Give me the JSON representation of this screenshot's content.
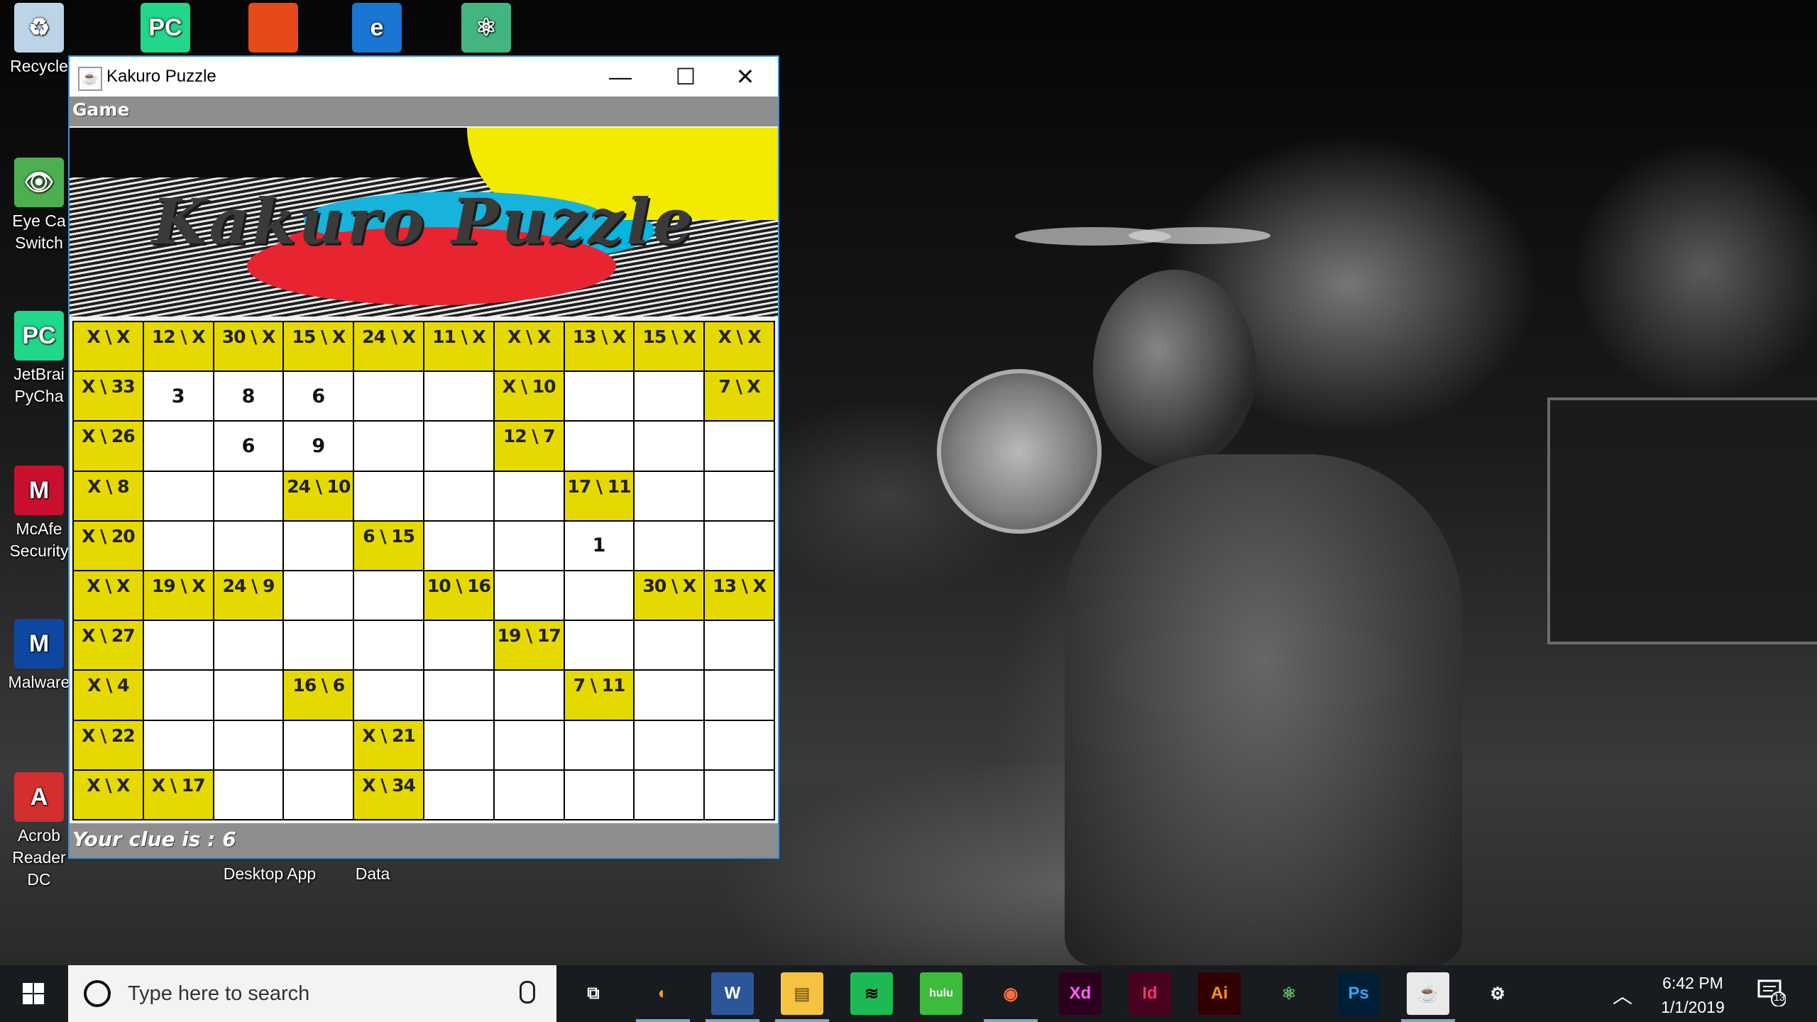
{
  "desktop": {
    "icons": [
      {
        "label": "Recycle",
        "glyph": "♻",
        "color": "#bcd3e8"
      },
      {
        "label": "Eye Ca\nSwitch",
        "glyph": "👁",
        "color": "#4caf50"
      },
      {
        "label": "JetBrai\nPyCha",
        "glyph": "PC",
        "color": "#21d789"
      },
      {
        "label": "McAfe\nSecurity",
        "glyph": "M",
        "color": "#c8102e"
      },
      {
        "label": "Malware",
        "glyph": "M",
        "color": "#0d47a1"
      },
      {
        "label": "Acrob\nReader DC",
        "glyph": "A",
        "color": "#d32f2f"
      }
    ],
    "top_icons": [
      {
        "label": "PC",
        "color": "#21d789"
      },
      {
        "label": "",
        "color": "#e64a19"
      },
      {
        "label": "e",
        "color": "#1976d2"
      },
      {
        "label": "⚛",
        "color": "#43b581"
      }
    ],
    "bottom_labels": [
      "Desktop App",
      "Data"
    ]
  },
  "window": {
    "title": "Kakuro Puzzle",
    "menu": [
      "Game"
    ],
    "banner_title": "Kakuro Puzzle",
    "controls": {
      "minimize": "—",
      "maximize": "☐",
      "close": "✕"
    },
    "status": "Your clue is :  6"
  },
  "grid": [
    [
      "X \\ X",
      "12 \\ X",
      "30 \\ X",
      "15 \\ X",
      "24 \\ X",
      "11 \\ X",
      "X \\ X",
      "13 \\ X",
      "15 \\ X",
      "X \\ X"
    ],
    [
      "X \\ 33",
      "3",
      "8",
      "6",
      "",
      "",
      "X \\ 10",
      "",
      "",
      "7 \\ X"
    ],
    [
      "X \\ 26",
      "",
      "6",
      "9",
      "",
      "",
      "12 \\ 7",
      "",
      "",
      ""
    ],
    [
      "X \\ 8",
      "",
      "",
      "24 \\ 10",
      "",
      "",
      "",
      "17 \\ 11",
      "",
      ""
    ],
    [
      "X \\ 20",
      "",
      "",
      "",
      "6 \\ 15",
      "",
      "",
      "1",
      "",
      ""
    ],
    [
      "X \\ X",
      "19 \\ X",
      "24 \\ 9",
      "",
      "",
      "10 \\ 16",
      "",
      "",
      "30 \\ X",
      "13 \\ X"
    ],
    [
      "X \\ 27",
      "",
      "",
      "",
      "",
      "",
      "19 \\ 17",
      "",
      "",
      ""
    ],
    [
      "X \\ 4",
      "",
      "",
      "16 \\ 6",
      "",
      "",
      "",
      "7 \\ 11",
      "",
      ""
    ],
    [
      "X \\ 22",
      "",
      "",
      "",
      "X \\ 21",
      "",
      "",
      "",
      "",
      ""
    ],
    [
      "X \\ X",
      "X \\ 17",
      "",
      "",
      "X \\ 34",
      "",
      "",
      "",
      "",
      ""
    ]
  ],
  "taskbar": {
    "search_placeholder": "Type here to search",
    "apps": [
      {
        "name": "task-view",
        "label": "⧉",
        "bg": "transparent",
        "fg": "#fff"
      },
      {
        "name": "eclipse",
        "label": "◐",
        "bg": "transparent",
        "fg": "#f0a030"
      },
      {
        "name": "word",
        "label": "W",
        "bg": "#2b579a",
        "fg": "#fff"
      },
      {
        "name": "file-explorer",
        "label": "▤",
        "bg": "#f5c242",
        "fg": "#8a6d1a"
      },
      {
        "name": "spotify",
        "label": "≋",
        "bg": "#1db954",
        "fg": "#000"
      },
      {
        "name": "hulu",
        "label": "hulu",
        "bg": "#3dbb3d",
        "fg": "#fff"
      },
      {
        "name": "firefox",
        "label": "◉",
        "bg": "transparent",
        "fg": "#ff7139"
      },
      {
        "name": "adobe-xd",
        "label": "Xd",
        "bg": "#2e001f",
        "fg": "#ff61f6"
      },
      {
        "name": "indesign",
        "label": "Id",
        "bg": "#49021f",
        "fg": "#ff3366"
      },
      {
        "name": "illustrator",
        "label": "Ai",
        "bg": "#330000",
        "fg": "#ff9a00"
      },
      {
        "name": "atom",
        "label": "⚛",
        "bg": "transparent",
        "fg": "#66bb6a"
      },
      {
        "name": "photoshop",
        "label": "Ps",
        "bg": "#001e36",
        "fg": "#31a8ff"
      },
      {
        "name": "java",
        "label": "☕",
        "bg": "#e9e9e9",
        "fg": "#e76f00"
      },
      {
        "name": "settings",
        "label": "⚙",
        "bg": "transparent",
        "fg": "#fff"
      }
    ],
    "active_apps": [
      "eclipse",
      "word",
      "file-explorer",
      "firefox",
      "java"
    ],
    "time": "6:42 PM",
    "date": "1/1/2019",
    "notification_count": "13"
  }
}
